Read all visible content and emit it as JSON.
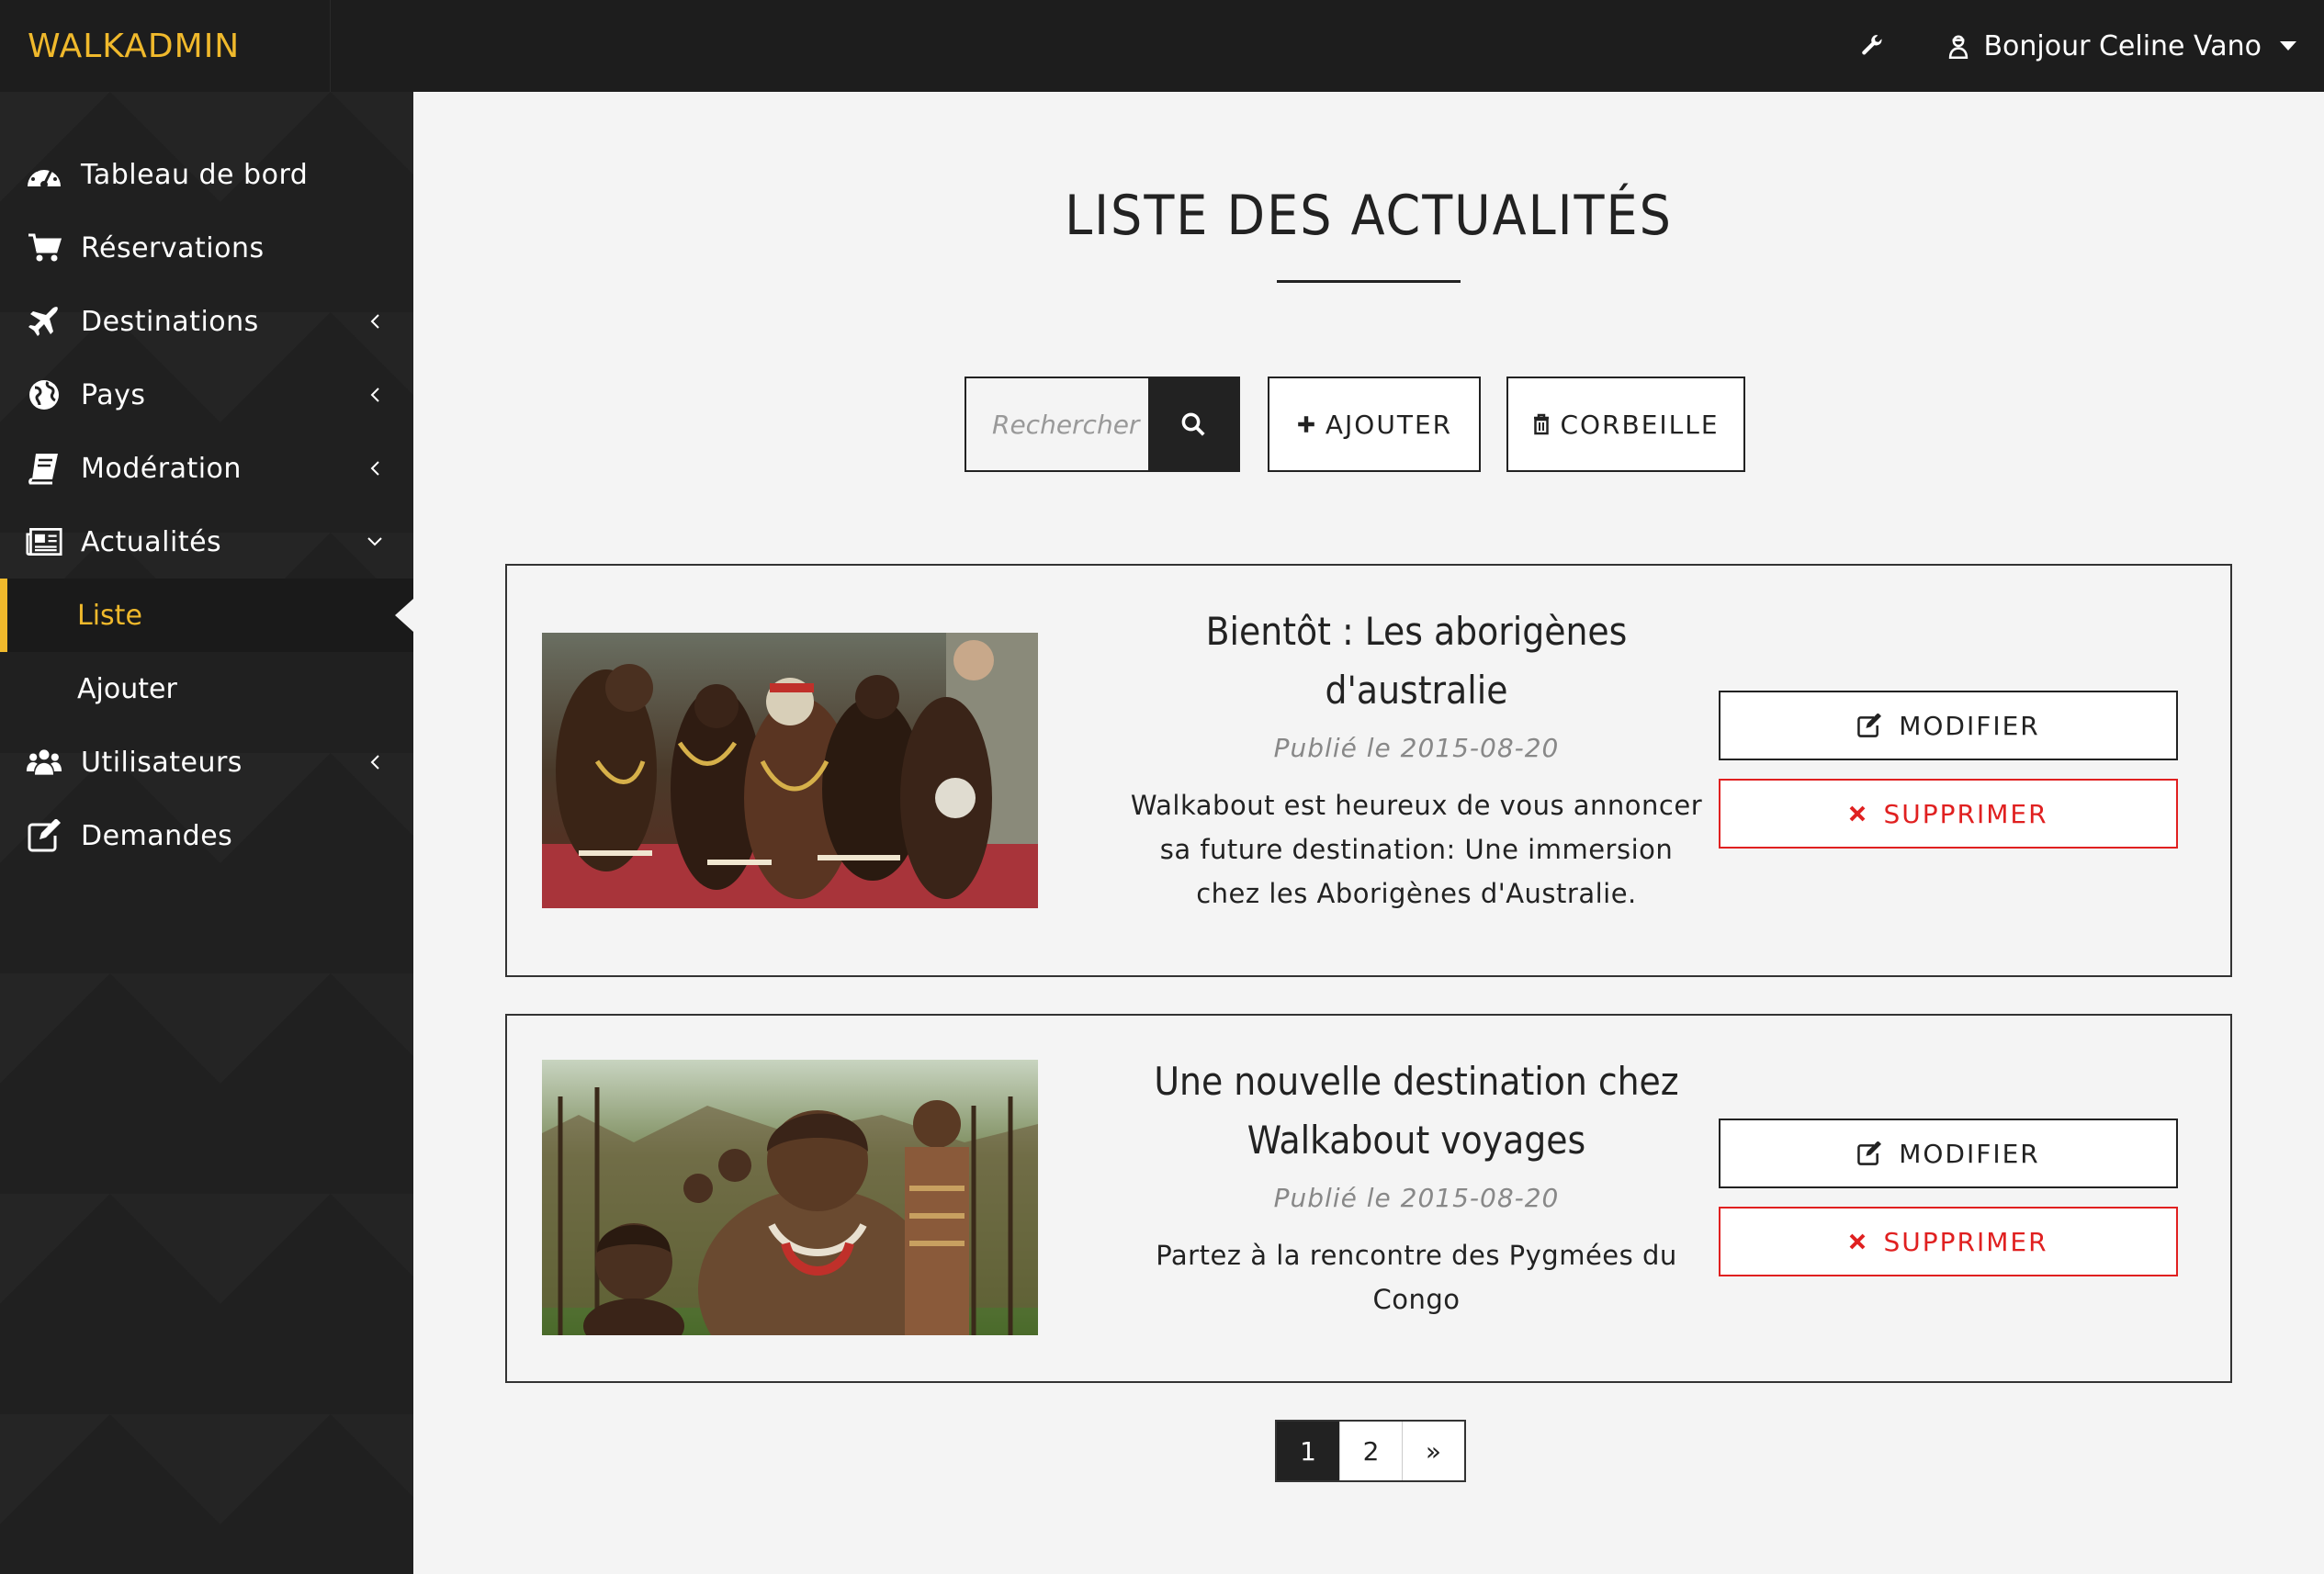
{
  "app": {
    "brand": "WALKADMIN",
    "greeting": "Bonjour Celine Vano"
  },
  "icons": {
    "wrench": "wrench-icon",
    "user": "user-secret-icon",
    "search": "search-icon",
    "add": "plus-icon",
    "trash": "trash-icon",
    "edit": "edit-icon",
    "delete": "times-icon"
  },
  "colors": {
    "accent": "#f0b92c",
    "danger": "#e02020",
    "sidebar": "#202020",
    "topbar": "#1d1d1d"
  },
  "sidebar": {
    "items": [
      {
        "label": "Tableau de bord",
        "icon": "dashboard-icon",
        "has_submenu": false
      },
      {
        "label": "Réservations",
        "icon": "cart-icon",
        "has_submenu": false
      },
      {
        "label": "Destinations",
        "icon": "plane-icon",
        "has_submenu": true
      },
      {
        "label": "Pays",
        "icon": "globe-icon",
        "has_submenu": true
      },
      {
        "label": "Modération",
        "icon": "book-icon",
        "has_submenu": true
      },
      {
        "label": "Actualités",
        "icon": "newspaper-icon",
        "has_submenu": true,
        "expanded": true
      },
      {
        "label": "Utilisateurs",
        "icon": "users-icon",
        "has_submenu": true
      },
      {
        "label": "Demandes",
        "icon": "edit-icon",
        "has_submenu": false
      }
    ],
    "submenu": [
      {
        "label": "Liste",
        "active": true
      },
      {
        "label": "Ajouter",
        "active": false
      }
    ]
  },
  "main": {
    "title": "LISTE DES ACTUALITÉS",
    "search_placeholder": "Rechercher",
    "add_label": "AJOUTER",
    "trash_label": "CORBEILLE",
    "articles": [
      {
        "title_line1": "Bientôt : Les aborigènes",
        "title_line2": "d'australie",
        "date": "Publié le 2015-08-20",
        "desc_line1": "Walkabout est heureux de vous annoncer",
        "desc_line2": "sa future destination: Une immersion",
        "desc_line3": "chez les Aborigènes d'Australie.",
        "edit_label": "MODIFIER",
        "delete_label": "SUPPRIMER"
      },
      {
        "title_line1": "Une nouvelle destination chez",
        "title_line2": "Walkabout voyages",
        "date": "Publié le 2015-08-20",
        "desc_line1": "Partez à la rencontre des Pygmées du",
        "desc_line2": "Congo",
        "edit_label": "MODIFIER",
        "delete_label": "SUPPRIMER"
      }
    ],
    "pagination": {
      "pages": [
        "1",
        "2"
      ],
      "next": "»",
      "current": "1"
    }
  }
}
